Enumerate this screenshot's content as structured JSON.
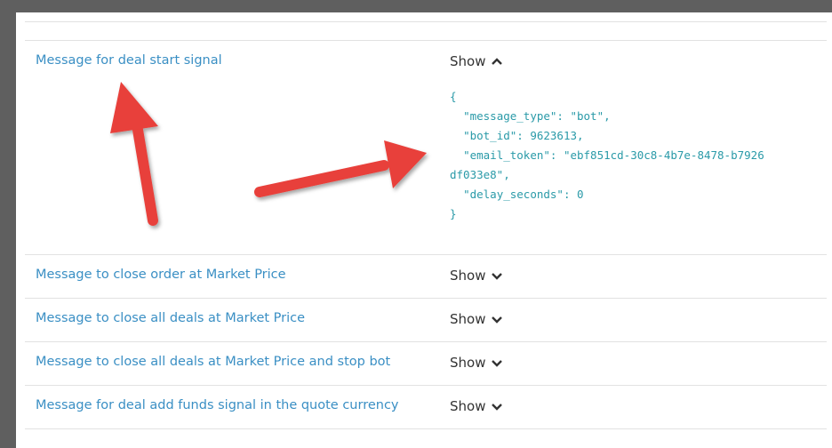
{
  "rows": [
    {
      "label": "Message for deal start signal",
      "toggle": "Show",
      "expanded": true,
      "code_lines": [
        "{",
        "  \"message_type\": \"bot\",",
        "  \"bot_id\": 9623613,",
        "  \"email_token\": \"ebf851cd-30c8-4b7e-8478-b7926",
        "df033e8\",",
        "  \"delay_seconds\": 0",
        "}"
      ]
    },
    {
      "label": "Message to close order at Market Price",
      "toggle": "Show",
      "expanded": false
    },
    {
      "label": "Message to close all deals at Market Price",
      "toggle": "Show",
      "expanded": false
    },
    {
      "label": "Message to close all deals at Market Price and stop bot",
      "toggle": "Show",
      "expanded": false
    },
    {
      "label": "Message for deal add funds signal in the quote currency",
      "toggle": "Show",
      "expanded": false
    },
    {
      "label": "",
      "toggle": "",
      "expanded": false
    }
  ],
  "colors": {
    "link": "#3a8fc4",
    "code": "#2a9aa8",
    "arrow": "#e8403a"
  }
}
